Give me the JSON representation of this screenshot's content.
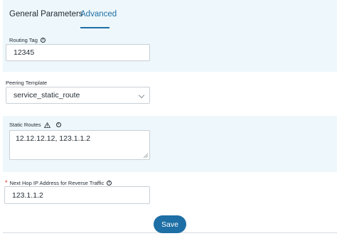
{
  "tabs": {
    "general": "General Parameters",
    "advanced": "Advanced"
  },
  "routing_tag": {
    "label": "Routing Tag",
    "value": "12345"
  },
  "peering_template": {
    "label": "Peering Template",
    "selected": "service_static_route"
  },
  "static_routes": {
    "label": "Static Routes",
    "value": "12.12.12.12, 123.1.1.2"
  },
  "next_hop": {
    "required_marker": "*",
    "label": "Next Hop IP Address for Reverse Traffic",
    "value": "123.1.1.2"
  },
  "actions": {
    "save_label": "Save"
  },
  "colors": {
    "accent": "#1d6fa5",
    "panel_bg": "#eef7fb",
    "required": "#d0271d"
  }
}
